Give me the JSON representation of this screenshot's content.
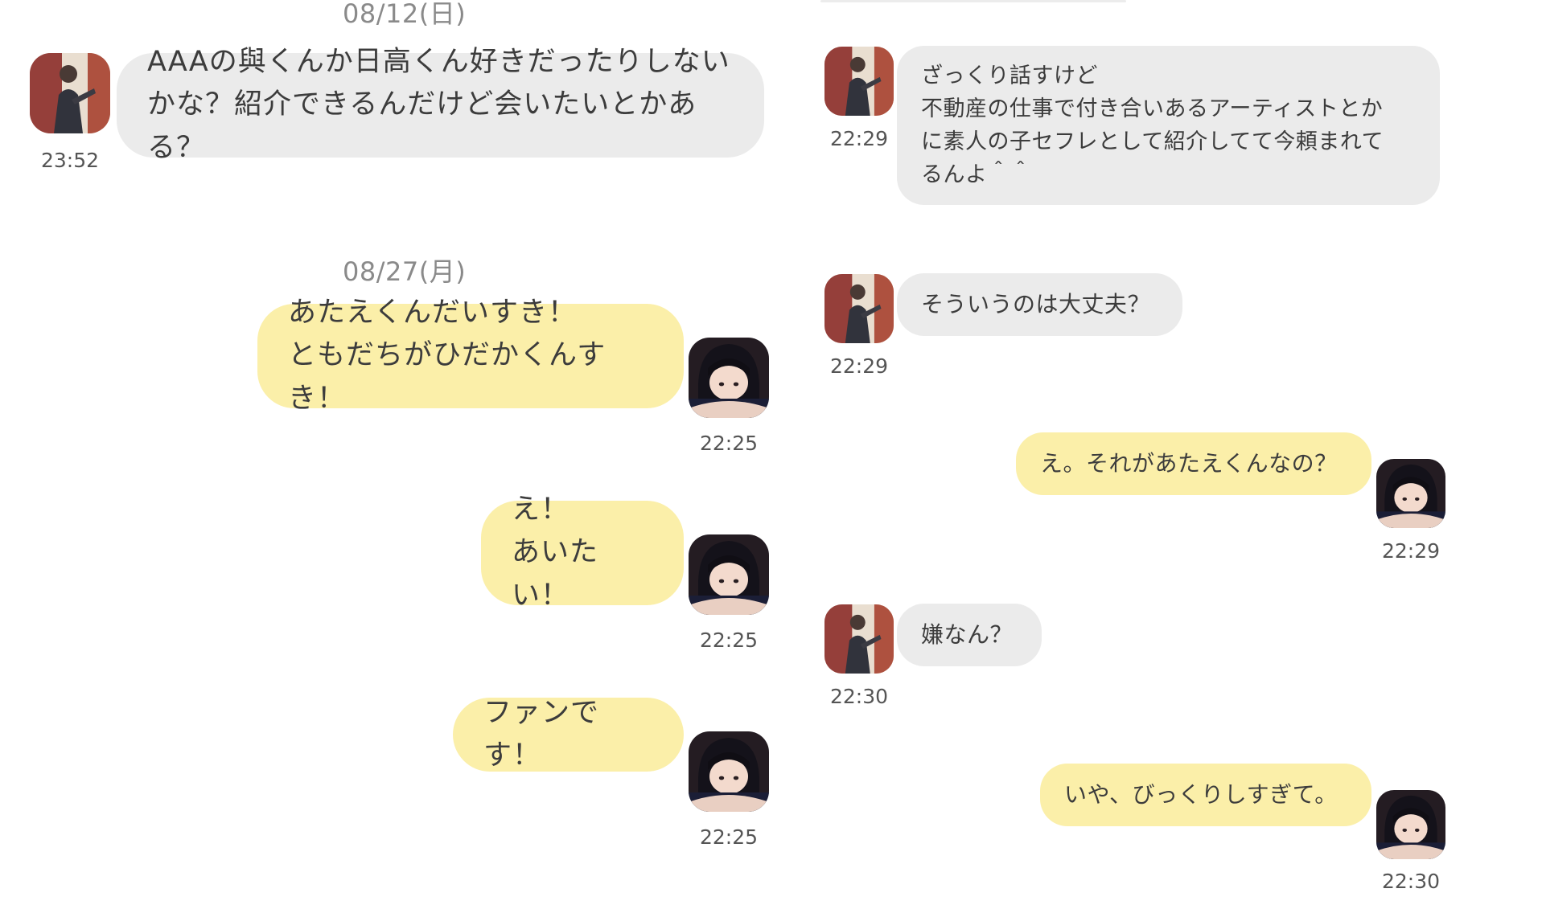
{
  "left_column": {
    "date_first": "08/12(日)",
    "msg_first": {
      "text": "AAAの與くんか日高くん好きだったりしない\nかな？紹介できるんだけど会いたいとかある？",
      "time": "23:52"
    },
    "date_second": "08/27(月)",
    "msgs": [
      {
        "text": "あたえくんだいすき！\nともだちがひだかくんすき！",
        "time": "22:25"
      },
      {
        "text": "え！\nあいたい！",
        "time": "22:25"
      },
      {
        "text": "ファンです！",
        "time": "22:25"
      }
    ]
  },
  "right_column": {
    "msgs": [
      {
        "text": "ざっくり話すけど\n不動産の仕事で付き合いあるアーティストとか\nに素人の子セフレとして紹介してて今頼まれて\nるんよ＾＾",
        "time": "22:29"
      },
      {
        "text": "そういうのは大丈夫？",
        "time": "22:29"
      },
      {
        "text": "え。それがあたえくんなの？",
        "time": "22:29"
      },
      {
        "text": "嫌なん？",
        "time": "22:30"
      },
      {
        "text": "いや、びっくりしすぎて。",
        "time": "22:30"
      }
    ]
  },
  "colors": {
    "received_bubble": "#ebebeb",
    "sent_bubble": "#fbefa9",
    "date_text": "#8a8a8a",
    "time_text": "#555555"
  },
  "avatars": {
    "received": "male-photo-avatar",
    "sent": "female-photo-avatar"
  }
}
